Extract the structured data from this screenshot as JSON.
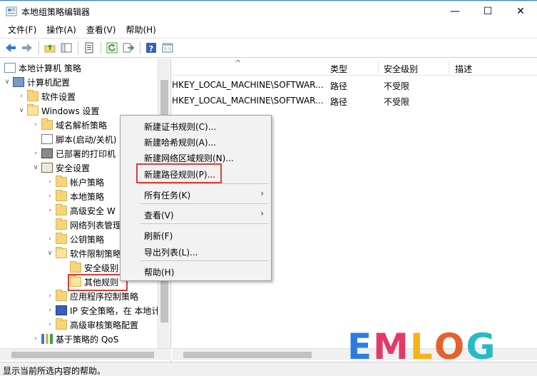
{
  "window": {
    "title": "本地组策略编辑器",
    "controls": {
      "minimize": "—",
      "maximize": "☐",
      "close": "✕"
    }
  },
  "menubar": [
    "文件(F)",
    "操作(A)",
    "查看(V)",
    "帮助(H)"
  ],
  "toolbar": {
    "buttons": [
      "back-icon",
      "forward-icon",
      "up-folder-icon",
      "show-hide-tree-icon",
      "properties-icon",
      "refresh-icon",
      "export-list-icon",
      "help-icon",
      "console-view-icon"
    ]
  },
  "tree": {
    "items": [
      {
        "label": "本地计算机 策略",
        "arrow": "",
        "icon": "policy-icon"
      },
      {
        "label": "计算机配置",
        "arrow": "∨",
        "icon": "computer-icon"
      },
      {
        "label": "软件设置",
        "arrow": "›",
        "icon": "folder-icon"
      },
      {
        "label": "Windows 设置",
        "arrow": "∨",
        "icon": "folder-open-icon"
      },
      {
        "label": "域名解析策略",
        "arrow": "›",
        "icon": "folder-icon"
      },
      {
        "label": "脚本(启动/关机)",
        "arrow": "",
        "icon": "script-icon"
      },
      {
        "label": "已部署的打印机",
        "arrow": "›",
        "icon": "printer-icon"
      },
      {
        "label": "安全设置",
        "arrow": "∨",
        "icon": "security-icon"
      },
      {
        "label": "帐户策略",
        "arrow": "›",
        "icon": "folder-lock-icon"
      },
      {
        "label": "本地策略",
        "arrow": "›",
        "icon": "folder-lock-icon"
      },
      {
        "label": "高级安全 W",
        "arrow": "›",
        "icon": "folder-icon"
      },
      {
        "label": "网络列表管理",
        "arrow": "",
        "icon": "folder-icon"
      },
      {
        "label": "公钥策略",
        "arrow": "›",
        "icon": "folder-icon"
      },
      {
        "label": "软件限制策略",
        "arrow": "∨",
        "icon": "folder-open-icon"
      },
      {
        "label": "安全级别",
        "arrow": "",
        "icon": "folder-icon"
      },
      {
        "label": "其他规则",
        "arrow": "",
        "icon": "folder-open-icon"
      },
      {
        "label": "应用程序控制策略",
        "arrow": "›",
        "icon": "folder-icon"
      },
      {
        "label": "IP 安全策略，在 本地计",
        "arrow": "›",
        "icon": "ip-security-icon"
      },
      {
        "label": "高级审核策略配置",
        "arrow": "›",
        "icon": "folder-icon"
      },
      {
        "label": "基于策略的 QoS",
        "arrow": "›",
        "icon": "qos-chart-icon"
      }
    ]
  },
  "list": {
    "columns": [
      "",
      "类型",
      "安全级别",
      "描述"
    ],
    "rows": [
      [
        "HKEY_LOCAL_MACHINE\\SOFTWAR...",
        "路径",
        "不受限",
        ""
      ],
      [
        "HKEY_LOCAL_MACHINE\\SOFTWAR...",
        "路径",
        "不受限",
        ""
      ]
    ]
  },
  "context_menu": {
    "items": [
      {
        "label": "新建证书规则(C)...",
        "submenu": false
      },
      {
        "label": "新建哈希规则(A)...",
        "submenu": false
      },
      {
        "label": "新建网络区域规则(N)...",
        "submenu": false
      },
      {
        "label": "新建路径规则(P)...",
        "submenu": false
      },
      {
        "label": "所有任务(K)",
        "submenu": true
      },
      {
        "label": "查看(V)",
        "submenu": true
      },
      {
        "label": "刷新(F)",
        "submenu": false
      },
      {
        "label": "导出列表(L)...",
        "submenu": false
      },
      {
        "label": "帮助(H)",
        "submenu": false
      }
    ],
    "submenu_arrow": "›"
  },
  "statusbar": {
    "text": "显示当前所选内容的帮助。"
  },
  "watermark": {
    "letters": [
      "E",
      "M",
      "L",
      "O",
      "G"
    ],
    "colors": [
      "#2d7be0",
      "#e23a6a",
      "#f2b31b",
      "#e8612c",
      "#27b9c9"
    ]
  },
  "colors": {
    "highlight_box": "#e03a3a",
    "folder": "#f6d57a"
  }
}
